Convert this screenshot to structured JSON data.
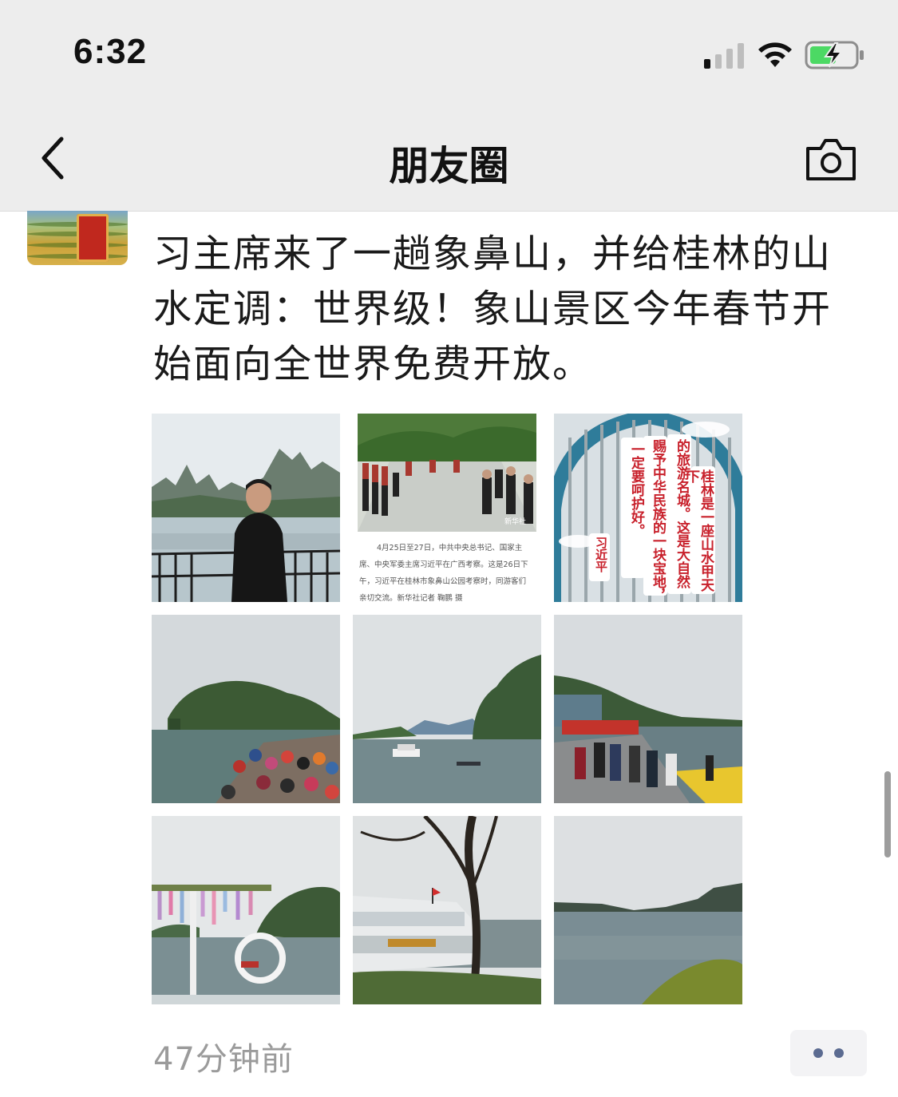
{
  "status_bar": {
    "time": "6:32",
    "signal_icon": "cellular-signal-icon",
    "wifi_icon": "wifi-icon",
    "battery_icon": "battery-charging-icon"
  },
  "nav": {
    "title": "朋友圈",
    "back_icon": "chevron-left-icon",
    "camera_icon": "camera-icon"
  },
  "post": {
    "text_lines": [
      "习主席来了一趟象鼻山，并给桂林的山",
      "水定调：世界级！象山景区今年春节开",
      "始面向全世界免费开放。"
    ],
    "timestamp": "47分钟前",
    "more_icon": "more-dots-icon",
    "photos": [
      {
        "name": "photo-1"
      },
      {
        "name": "photo-2",
        "caption": [
          "4月25日至27日，中共中央总书记、国家主",
          "席、中央军委主席习近平在广西考察。这是26日下",
          "午，习近平在桂林市象鼻山公园考察时，同游客们",
          "亲切交流。新华社记者 鞠鹏 摄"
        ],
        "tag": "新华社"
      },
      {
        "name": "photo-3",
        "col1": "桂林是一座山水甲天下",
        "col2": "的旅游名城。这是大自然",
        "col3": "赐予中华民族的一块宝地，",
        "col4": "一定要呵护好。",
        "sig": "习近平"
      },
      {
        "name": "photo-4"
      },
      {
        "name": "photo-5"
      },
      {
        "name": "photo-6"
      },
      {
        "name": "photo-7"
      },
      {
        "name": "photo-8"
      },
      {
        "name": "photo-9"
      }
    ]
  },
  "colors": {
    "nav_bg": "#ededed",
    "link_blue": "#5b6b91",
    "timestamp_gray": "#9b9b9b"
  }
}
